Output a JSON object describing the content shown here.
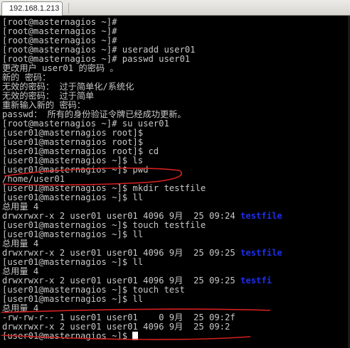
{
  "tab": {
    "title": "192.168.1.213"
  },
  "terminal": {
    "lines": [
      "[root@masternagios ~]#",
      "[root@masternagios ~]#",
      "[root@masternagios ~]#",
      "[root@masternagios ~]# useradd user01",
      "[root@masternagios ~]# passwd user01",
      "更改用户 user01 的密码 。",
      "新的 密码：",
      "无效的密码： 过于简单化/系统化",
      "无效的密码： 过于简单",
      "重新输入新的 密码：",
      "passwd： 所有的身份验证令牌已经成功更新。",
      "[root@masternagios ~]# su user01",
      "[user01@masternagios root]$",
      "[user01@masternagios root]$",
      "[user01@masternagios root]$ cd",
      "[user01@masternagios ~]$ ls",
      "[user01@masternagios ~]$ pwd",
      "/home/user01",
      "[user01@masternagios ~]$ mkdir testfile",
      "[user01@masternagios ~]$ ll",
      "总用量 4",
      "drwxrwxr-x 2 user01 user01 4096 9月  25 09:24 ",
      "[user01@masternagios ~]$ touch testfile",
      "[user01@masternagios ~]$ ll",
      "总用量 4",
      "drwxrwxr-x 2 user01 user01 4096 9月  25 09:25 ",
      "[user01@masternagios ~]$ ll",
      "总用量 4",
      "drwxrwxr-x 2 user01 user01 4096 9月  25 09:25 ",
      "[user01@masternagios ~]$ touch test",
      "[user01@masternagios ~]$ ll",
      "总用量 4",
      "-rw-rw-r-- 1 user01 user01    0 9月  25 09:2f",
      "drwxrwxr-x 2 user01 user01 4096 9月  25 09:2",
      "[user01@masternagios ~]$ "
    ],
    "dir_entries": [
      {
        "line": 21,
        "text": "testfile"
      },
      {
        "line": 25,
        "text": "testfile"
      },
      {
        "line": 28,
        "text": "testfi"
      }
    ]
  },
  "colors": {
    "terminal_bg": "#000000",
    "terminal_fg": "#c8c8c8",
    "directory": "#1e2ee8",
    "annotation": "#d42020"
  }
}
